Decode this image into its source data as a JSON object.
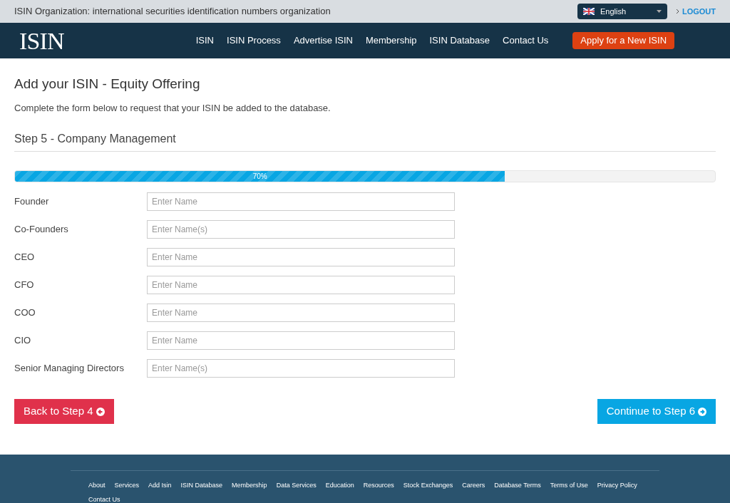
{
  "top_bar": {
    "title": "ISIN Organization: international securities identification numbers organization",
    "language": "English",
    "logout": "LOGOUT"
  },
  "nav": {
    "logo": "ISIN",
    "links": [
      "ISIN",
      "ISIN Process",
      "Advertise ISIN",
      "Membership",
      "ISIN Database",
      "Contact Us"
    ],
    "cta": "Apply for a New ISIN"
  },
  "page": {
    "title": "Add your ISIN - Equity Offering",
    "intro": "Complete the form below to request that your ISIN be added to the database.",
    "step_title": "Step 5 - Company Management"
  },
  "progress": {
    "level": 0.7,
    "label": "70%"
  },
  "fields": [
    {
      "label": "Founder",
      "placeholder": "Enter Name"
    },
    {
      "label": "Co-Founders",
      "placeholder": "Enter Name(s)"
    },
    {
      "label": "CEO",
      "placeholder": "Enter Name"
    },
    {
      "label": "CFO",
      "placeholder": "Enter Name"
    },
    {
      "label": "COO",
      "placeholder": "Enter Name"
    },
    {
      "label": "CIO",
      "placeholder": "Enter Name"
    },
    {
      "label": "Senior Managing Directors",
      "placeholder": "Enter Name(s)"
    }
  ],
  "buttons": {
    "back": "Back to Step 4",
    "continue": "Continue to Step 6"
  },
  "footer": {
    "links": [
      "About",
      "Services",
      "Add Isin",
      "ISIN Database",
      "Membership",
      "Data Services",
      "Education",
      "Resources",
      "Stock Exchanges",
      "Careers",
      "Database Terms",
      "Terms of Use",
      "Privacy Policy",
      "Contact Us"
    ]
  }
}
